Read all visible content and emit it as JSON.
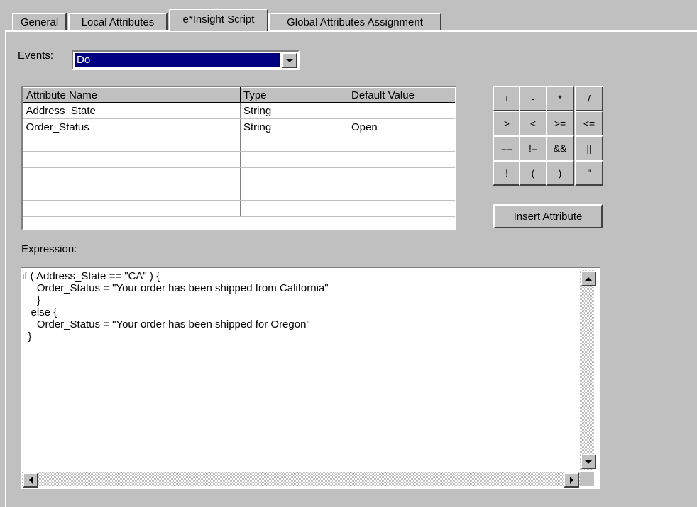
{
  "tabs": [
    {
      "label": "General",
      "active": false
    },
    {
      "label": "Local Attributes",
      "active": false
    },
    {
      "label": "e*Insight Script",
      "active": true
    },
    {
      "label": "Global Attributes Assignment",
      "active": false
    }
  ],
  "events": {
    "label": "Events:",
    "selected": "Do"
  },
  "attributes_table": {
    "headers": [
      "Attribute Name",
      "Type",
      "Default Value"
    ],
    "rows": [
      [
        "Address_State",
        "String",
        ""
      ],
      [
        "Order_Status",
        "String",
        "Open"
      ],
      [
        "",
        "",
        ""
      ],
      [
        "",
        "",
        ""
      ],
      [
        "",
        "",
        ""
      ],
      [
        "",
        "",
        ""
      ],
      [
        "",
        "",
        ""
      ]
    ]
  },
  "operators": [
    "+",
    "-",
    "*",
    "/",
    ">",
    "<",
    ">=",
    "<=",
    "==",
    "!=",
    "&&",
    "||",
    "!",
    "(",
    ")",
    "\""
  ],
  "insert_attribute_label": "Insert Attribute",
  "expression": {
    "label": "Expression:",
    "text": "if ( Address_State == \"CA\" ) {\n     Order_Status = \"Your order has been shipped from California\"\n     }\n   else {\n     Order_Status = \"Your order has been shipped for Oregon\"\n  }"
  },
  "colors": {
    "face": "#c0c0c0",
    "selection": "#000080"
  }
}
